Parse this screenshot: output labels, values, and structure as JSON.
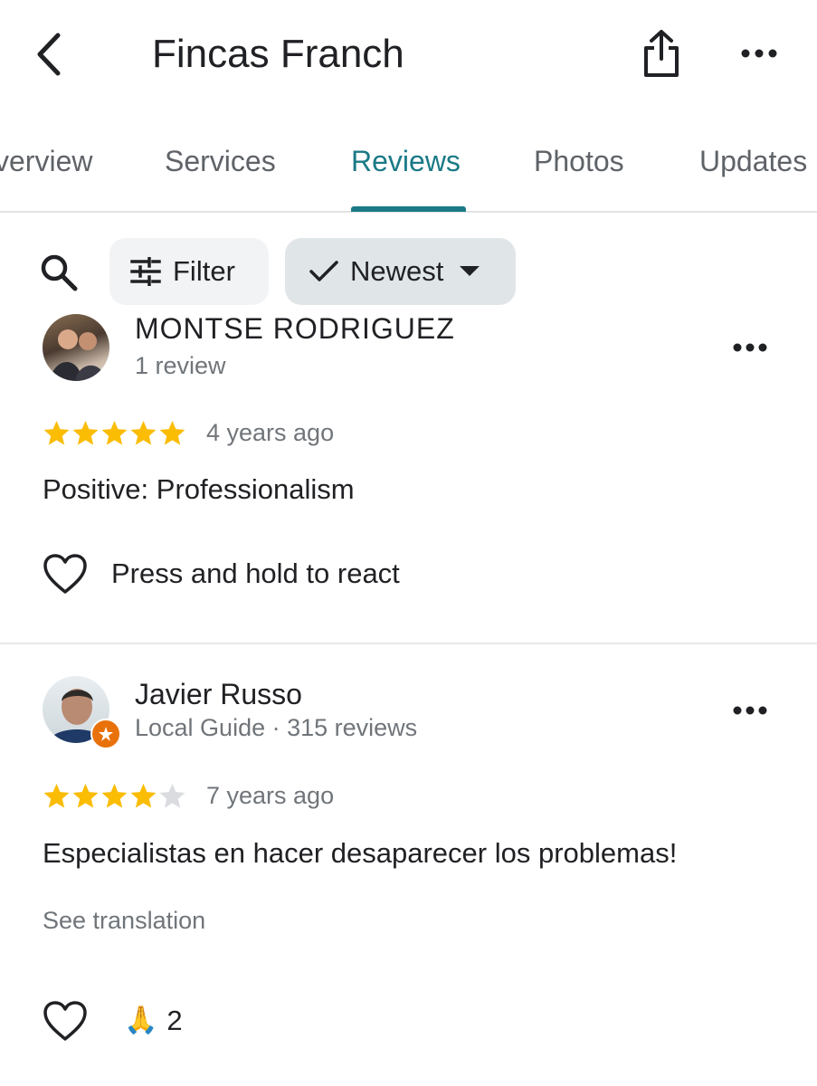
{
  "header": {
    "back_icon": "chevron-left-icon",
    "title": "Fincas Franch",
    "share_icon": "share-icon",
    "more_icon": "more-horizontal-icon"
  },
  "tabs": [
    {
      "label": "Overview",
      "shown": "verview",
      "active": false
    },
    {
      "label": "Services",
      "active": false
    },
    {
      "label": "Reviews",
      "active": true
    },
    {
      "label": "Photos",
      "active": false
    },
    {
      "label": "Updates",
      "active": false
    }
  ],
  "toolbar": {
    "search_icon": "search-icon",
    "filter_label": "Filter",
    "sort_label": "Newest"
  },
  "reviews": [
    {
      "author": "MONTSE RODRIGUEZ",
      "meta": "1 review",
      "rating": 5,
      "time": "4 years ago",
      "positive_label": "Positive:",
      "positive_value": " Professionalism",
      "react_label": "Press and hold to react"
    },
    {
      "author": "Javier Russo",
      "meta": "Local Guide · 315 reviews",
      "rating": 4,
      "time": "7 years ago",
      "text": "Especialistas en hacer desaparecer los problemas!",
      "see_translation": "See translation",
      "reaction_emoji": "🙏",
      "reaction_count": "2"
    }
  ],
  "colors": {
    "accent": "#1a7a86",
    "star": "#fbbc04",
    "star_empty": "#dadce0",
    "local_guide_badge": "#e8710a"
  }
}
